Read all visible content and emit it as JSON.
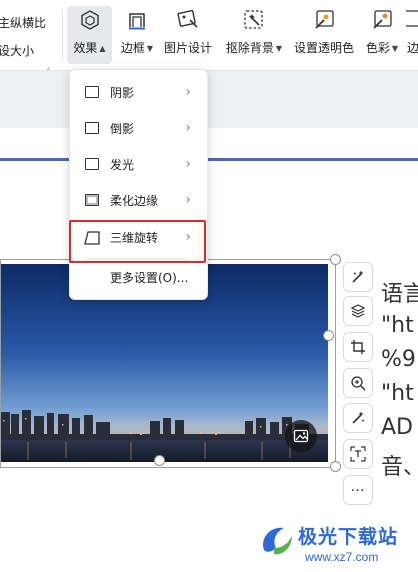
{
  "ribbon": {
    "left_line1": "主纵横比",
    "left_line2": "设大小",
    "buttons": [
      {
        "label": "效果",
        "has_caret": true
      },
      {
        "label": "边框",
        "has_caret": true
      },
      {
        "label": "图片设计",
        "has_caret": false
      },
      {
        "label": "抠除背景",
        "has_caret": true
      },
      {
        "label": "设置透明色",
        "has_caret": false
      },
      {
        "label": "色彩",
        "has_caret": true
      },
      {
        "label": "边",
        "has_caret": false
      }
    ]
  },
  "effects_menu": {
    "items": [
      {
        "label": "阴影"
      },
      {
        "label": "倒影"
      },
      {
        "label": "发光"
      },
      {
        "label": "柔化边缘"
      },
      {
        "label": "三维旋转"
      }
    ],
    "more": "更多设置(O)..."
  },
  "right_text": [
    "语言",
    "\"ht",
    "%9",
    "\"ht",
    "AD",
    "音、"
  ],
  "watermark": {
    "name": "极光下载站",
    "url": "www.xz7.com"
  },
  "colors": {
    "accent_line": "#4a69b8",
    "highlight_box": "#e02a2a",
    "watermark": "#2f68d8"
  }
}
